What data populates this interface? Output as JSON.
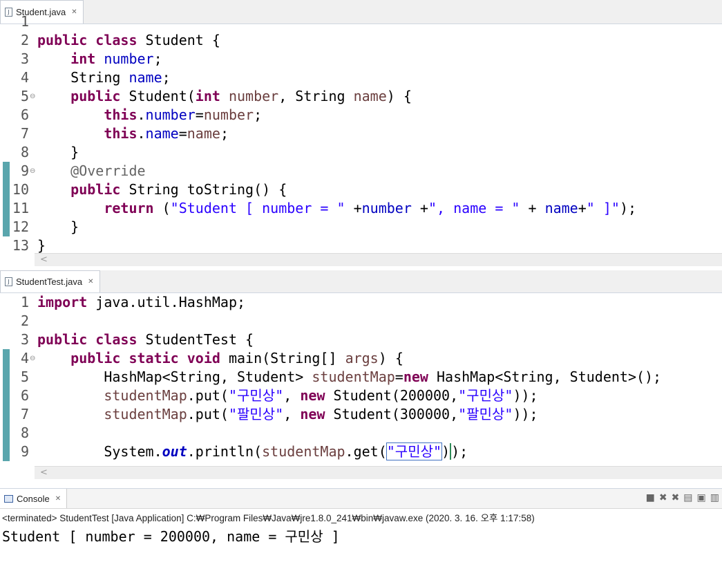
{
  "editor1": {
    "tab_title": "Student.java",
    "close_glyph": "✕",
    "lines": [
      {
        "n": "1",
        "code": ""
      },
      {
        "n": "2",
        "code": "public class Student {"
      },
      {
        "n": "3",
        "code": "    int number;"
      },
      {
        "n": "4",
        "code": "    String name;"
      },
      {
        "n": "5",
        "code": "    public Student(int number, String name) {"
      },
      {
        "n": "6",
        "code": "        this.number=number;"
      },
      {
        "n": "7",
        "code": "        this.name=name;"
      },
      {
        "n": "8",
        "code": "    }"
      },
      {
        "n": "9",
        "code": "    @Override"
      },
      {
        "n": "10",
        "code": "    public String toString() {"
      },
      {
        "n": "11",
        "code": "        return (\"Student [ number = \" +number +\", name = \" + name+\" ]\");"
      },
      {
        "n": "12",
        "code": "    }"
      },
      {
        "n": "13",
        "code": "}"
      }
    ]
  },
  "editor2": {
    "tab_title": "StudentTest.java",
    "close_glyph": "✕",
    "lines": [
      {
        "n": "1",
        "code": "import java.util.HashMap;"
      },
      {
        "n": "2",
        "code": ""
      },
      {
        "n": "3",
        "code": "public class StudentTest {"
      },
      {
        "n": "4",
        "code": "    public static void main(String[] args) {"
      },
      {
        "n": "5",
        "code": "        HashMap<String, Student> studentMap=new HashMap<String, Student>();"
      },
      {
        "n": "6",
        "code": "        studentMap.put(\"구민상\", new Student(200000,\"구민상\"));"
      },
      {
        "n": "7",
        "code": "        studentMap.put(\"팔민상\", new Student(300000,\"팔민상\"));"
      },
      {
        "n": "8",
        "code": ""
      },
      {
        "n": "9",
        "code": "        System.out.println(studentMap.get(\"구민상\"));"
      }
    ]
  },
  "console": {
    "tab_title": "Console",
    "close_glyph": "✕",
    "status": "<terminated> StudentTest [Java Application] C:₩Program Files₩Java₩jre1.8.0_241₩bin₩javaw.exe (2020. 3. 16. 오후 1:17:58)",
    "output": "Student [ number = 200000, name = 구민상 ]",
    "tool_icons": [
      "stop-icon",
      "remove-launch-icon",
      "remove-all-icon",
      "scroll-lock-icon",
      "pin-icon",
      "display-console-icon"
    ]
  },
  "scroll_glyph": "<"
}
